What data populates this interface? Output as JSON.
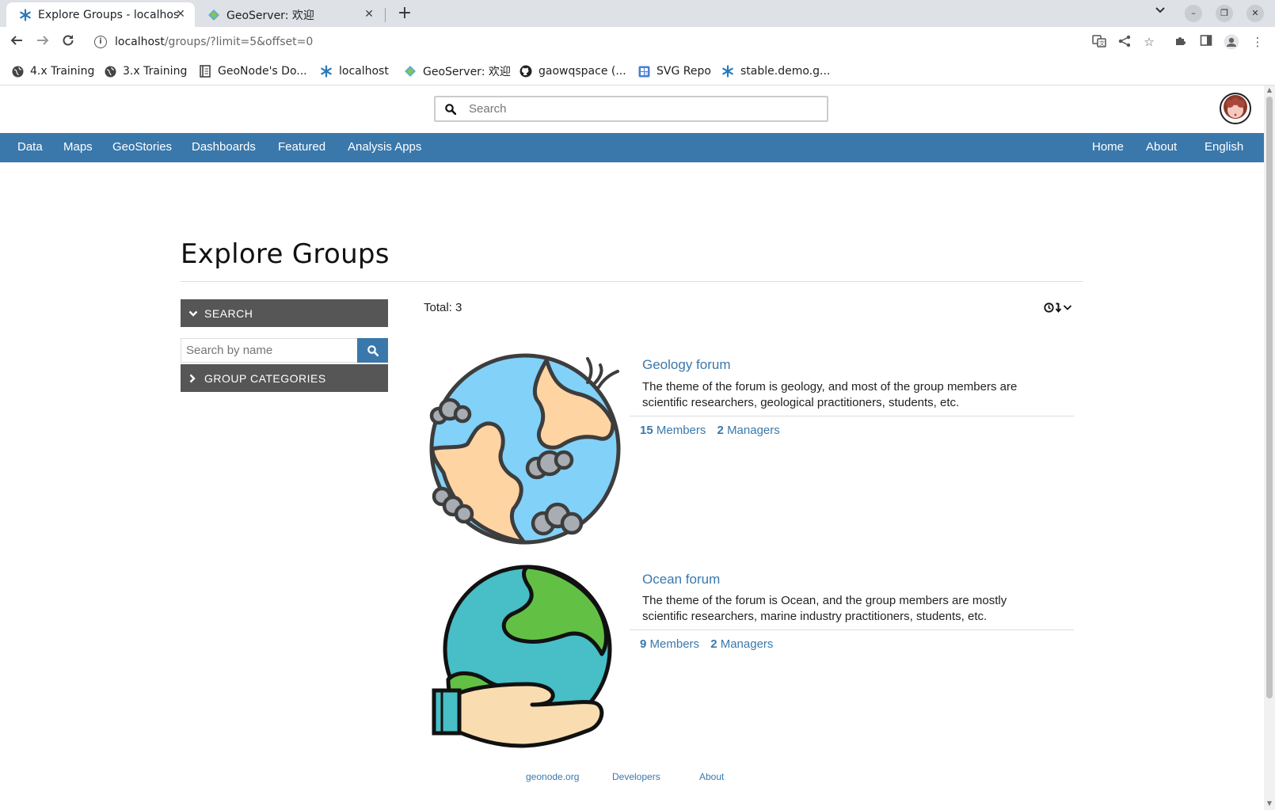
{
  "browser": {
    "tabs": [
      {
        "title": "Explore Groups - localhost",
        "active": true,
        "icon": "geonode-icon"
      },
      {
        "title": "GeoServer: 欢迎",
        "active": false,
        "icon": "geoserver-icon"
      }
    ],
    "address": {
      "host": "localhost",
      "path": "/groups/?limit=5&offset=0"
    },
    "bookmarks": [
      {
        "label": "4.x Training",
        "icon": "globe-icon"
      },
      {
        "label": "3.x Training",
        "icon": "globe-icon"
      },
      {
        "label": "GeoNode's Do...",
        "icon": "doc-icon"
      },
      {
        "label": "localhost",
        "icon": "geonode-icon"
      },
      {
        "label": "GeoServer: 欢迎",
        "icon": "geoserver-icon"
      },
      {
        "label": "gaowqspace (...",
        "icon": "github-icon"
      },
      {
        "label": "SVG Repo",
        "icon": "svgrepo-icon"
      },
      {
        "label": "stable.demo.g...",
        "icon": "geonode-icon"
      }
    ]
  },
  "site": {
    "search_placeholder": "Search",
    "nav_left": [
      "Data",
      "Maps",
      "GeoStories",
      "Dashboards",
      "Featured",
      "Analysis Apps"
    ],
    "nav_right": [
      "Home",
      "About",
      "English"
    ],
    "accent_color": "#3a78ab"
  },
  "page": {
    "title": "Explore Groups",
    "search_section": "SEARCH",
    "name_search_placeholder": "Search by name",
    "categories_section": "GROUP CATEGORIES",
    "total": "Total: 3"
  },
  "groups": [
    {
      "name": "Geology forum",
      "description": "The theme of the forum is geology, and most of the group members are scientific researchers, geological practitioners, students, etc.",
      "members_count": "15",
      "members_label": "Members",
      "managers_count": "2",
      "managers_label": "Managers"
    },
    {
      "name": "Ocean forum",
      "description": "The theme of the forum is Ocean, and the group members are mostly scientific researchers, marine industry practitioners, students, etc.",
      "members_count": "9",
      "members_label": "Members",
      "managers_count": "2",
      "managers_label": "Managers"
    }
  ],
  "footer": [
    "geonode.org",
    "Developers",
    "About"
  ]
}
